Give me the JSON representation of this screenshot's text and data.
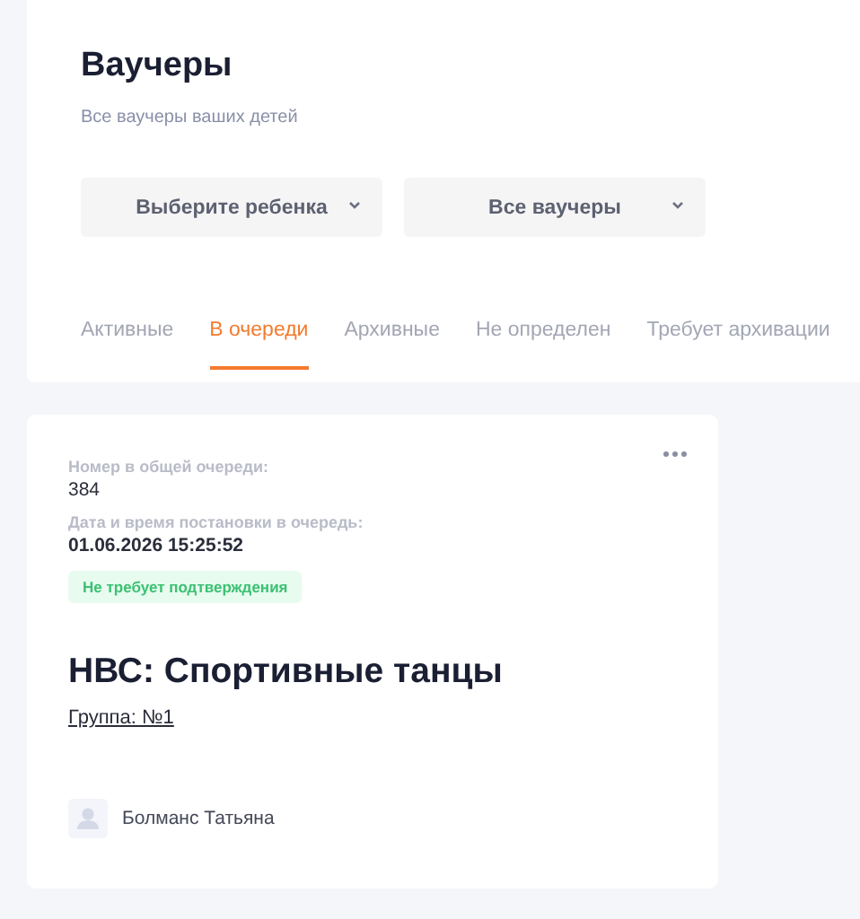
{
  "header": {
    "title": "Ваучеры",
    "subtitle": "Все ваучеры ваших детей",
    "filters": [
      {
        "label": "Выберите ребенка"
      },
      {
        "label": "Все ваучеры"
      }
    ],
    "tabs": [
      {
        "label": "Активные",
        "selected": false
      },
      {
        "label": "В очереди",
        "selected": true
      },
      {
        "label": "Архивные",
        "selected": false
      },
      {
        "label": "Не определен",
        "selected": false
      },
      {
        "label": "Требует архивации",
        "selected": false
      }
    ]
  },
  "voucher": {
    "queue_label": "Номер в общей очереди:",
    "queue_number": "384",
    "date_label": "Дата и время постановки в очередь:",
    "date": "01.06.2026 15:25:52",
    "status": "Не требует подтверждения",
    "title": "НВС: Спортивные танцы",
    "group_link": "Группа: №1",
    "child_name": "Болманс Татьяна"
  }
}
